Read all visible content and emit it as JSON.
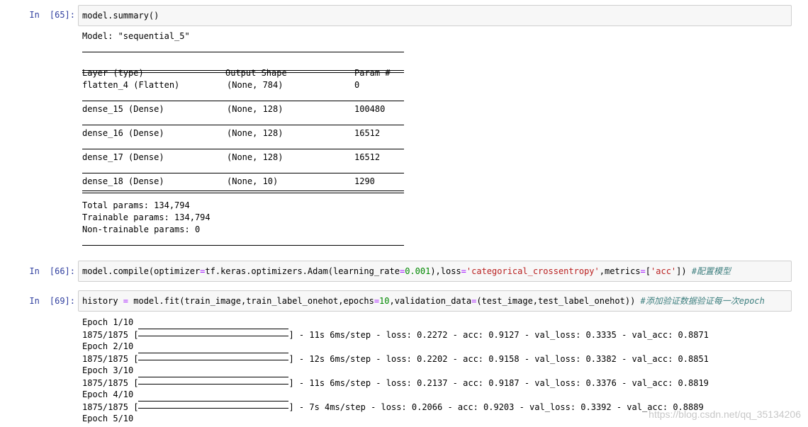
{
  "cells": {
    "c65": {
      "prompt_in": "In",
      "prompt_num": "[65]:",
      "code": "model.summary()"
    },
    "summary": {
      "model_line": "Model: \"sequential_5\"",
      "headers": [
        "Layer (type)",
        "Output Shape",
        "Param #"
      ],
      "rows": [
        [
          "flatten_4 (Flatten)",
          "(None, 784)",
          "0"
        ],
        [
          "dense_15 (Dense)",
          "(None, 128)",
          "100480"
        ],
        [
          "dense_16 (Dense)",
          "(None, 128)",
          "16512"
        ],
        [
          "dense_17 (Dense)",
          "(None, 128)",
          "16512"
        ],
        [
          "dense_18 (Dense)",
          "(None, 10)",
          "1290"
        ]
      ],
      "total": "Total params: 134,794",
      "trainable": "Trainable params: 134,794",
      "non_trainable": "Non-trainable params: 0"
    },
    "c66": {
      "prompt_in": "In",
      "prompt_num": "[66]:",
      "code_a": "model.compile(optimizer",
      "eq1": "=",
      "code_b": "tf.keras.optimizers.Adam(learning_rate",
      "eq2": "=",
      "num": "0.001",
      "code_c": "),loss",
      "eq3": "=",
      "str1": "'categorical_crossentropy'",
      "code_d": ",metrics",
      "eq4": "=",
      "code_e": "[",
      "str2": "'acc'",
      "code_f": "]) ",
      "comment": "#配置模型"
    },
    "c69": {
      "prompt_in": "In",
      "prompt_num": "[69]:",
      "code_a": "history ",
      "eq1": "=",
      "code_b": " model.fit(train_image,train_label_onehot,epochs",
      "eq2": "=",
      "num": "10",
      "code_c": ",validation_data",
      "eq3": "=",
      "code_d": "(test_image,test_label_onehot)) ",
      "comment": "#添加验证数据验证每一次epoch"
    },
    "training": [
      {
        "epoch": "Epoch 1/10",
        "steps": "1875/1875 [",
        "rest": "] - 11s 6ms/step - loss: 0.2272 - acc: 0.9127 - val_loss: 0.3335 - val_acc: 0.8871"
      },
      {
        "epoch": "Epoch 2/10",
        "steps": "1875/1875 [",
        "rest": "] - 12s 6ms/step - loss: 0.2202 - acc: 0.9158 - val_loss: 0.3382 - val_acc: 0.8851"
      },
      {
        "epoch": "Epoch 3/10",
        "steps": "1875/1875 [",
        "rest": "] - 11s 6ms/step - loss: 0.2137 - acc: 0.9187 - val_loss: 0.3376 - val_acc: 0.8819"
      },
      {
        "epoch": "Epoch 4/10",
        "steps": "1875/1875 [",
        "rest": "] - 7s 4ms/step - loss: 0.2066 - acc: 0.9203 - val_loss: 0.3392 - val_acc: 0.8889"
      },
      {
        "epoch": "Epoch 5/10"
      }
    ],
    "watermark": "https://blog.csdn.net/qq_35134206"
  }
}
